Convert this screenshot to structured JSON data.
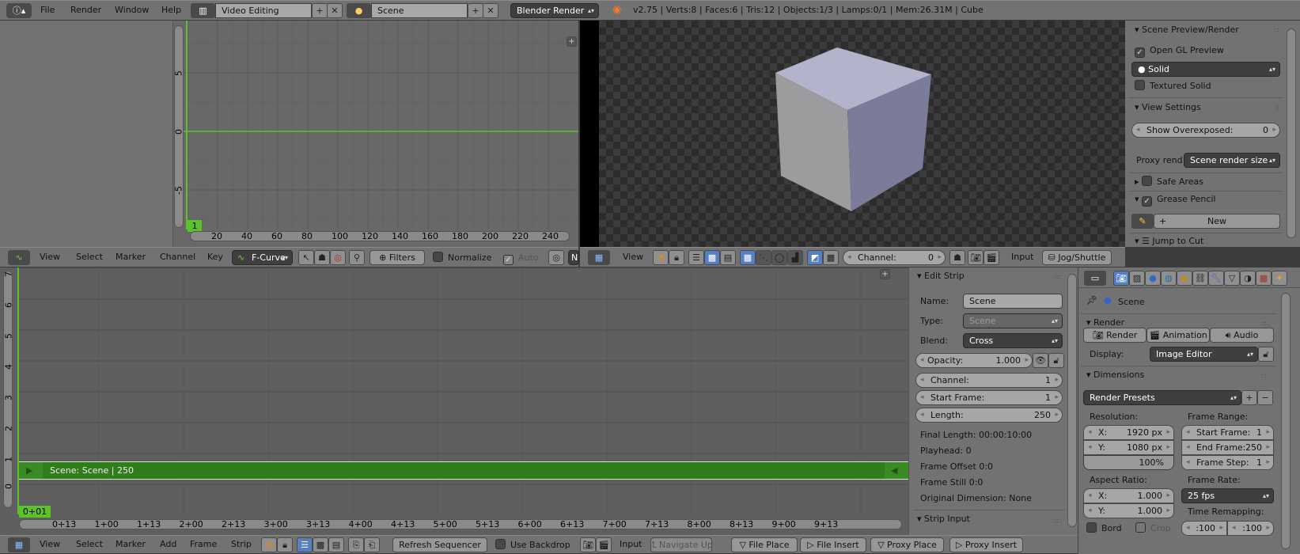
{
  "colors": {
    "accent_green": "#5bc22a",
    "strip_green": "#2f7d1b",
    "selection_blue": "#5680c2",
    "header": "#727272"
  },
  "topbar": {
    "info_icon": "info-icon",
    "menus": [
      "File",
      "Render",
      "Window",
      "Help"
    ],
    "screen_layout": "Video Editing",
    "scene": "Scene",
    "render_engine": "Blender Render",
    "stats": "v2.75 | Verts:8 | Faces:6 | Tris:12 | Objects:1/3 | Lamps:0/1 | Mem:26.31M | Cube"
  },
  "graph_editor": {
    "x_ticks": [
      "20",
      "40",
      "60",
      "80",
      "100",
      "120",
      "140",
      "160",
      "180",
      "200",
      "220",
      "240"
    ],
    "y_ticks": [
      "5",
      "0",
      "-5"
    ],
    "current_frame": "1",
    "header": {
      "menus": [
        "View",
        "Select",
        "Marker",
        "Channel",
        "Key"
      ],
      "mode": "F-Curve",
      "filters": "Filters",
      "normalize": "Normalize",
      "auto": "Auto",
      "truncated": "N"
    }
  },
  "preview": {
    "header": {
      "view": "View",
      "channel_label": "Channel:",
      "channel_value": "0",
      "input": "Input",
      "jog_shuttle": "Jog/Shuttle"
    },
    "sidebar": {
      "scene_preview_title": "Scene Preview/Render",
      "open_gl_preview": "Open GL Preview",
      "open_gl_checked": true,
      "shading": "Solid",
      "textured_solid": "Textured Solid",
      "textured_solid_checked": false,
      "view_settings_title": "View Settings",
      "show_overexposed_label": "Show Overexposed:",
      "show_overexposed_value": "0",
      "proxy_label": "Proxy rend",
      "proxy_value": "Scene render size",
      "safe_areas": "Safe Areas",
      "grease_pencil": "Grease Pencil",
      "new_button": "New",
      "jump_to_cut": "Jump to Cut"
    }
  },
  "sequencer": {
    "channels": [
      "7",
      "6",
      "5",
      "4",
      "3",
      "2",
      "1",
      "0"
    ],
    "strip_label": "Scene: Scene | 250",
    "current_frame": "0+01",
    "time_ticks": [
      "0+13",
      "1+00",
      "1+13",
      "2+00",
      "2+13",
      "3+00",
      "3+13",
      "4+00",
      "4+13",
      "5+00",
      "5+13",
      "6+00",
      "6+13",
      "7+00",
      "7+13",
      "8+00",
      "8+13",
      "9+00",
      "9+13"
    ],
    "header": {
      "menus": [
        "View",
        "Select",
        "Marker",
        "Add",
        "Frame",
        "Strip"
      ],
      "refresh": "Refresh Sequencer",
      "use_backdrop": "Use Backdrop",
      "input": "Input",
      "navigate_up": "Navigate Up",
      "file_place": "File Place",
      "file_insert": "File Insert",
      "proxy_place": "Proxy Place",
      "proxy_insert": "Proxy Insert"
    }
  },
  "edit_strip": {
    "title": "Edit Strip",
    "name_label": "Name:",
    "name_value": "Scene",
    "type_label": "Type:",
    "type_value": "Scene",
    "blend_label": "Blend:",
    "blend_value": "Cross",
    "opacity_label": "Opacity:",
    "opacity_value": "1.000",
    "channel_label": "Channel:",
    "channel_value": "1",
    "start_label": "Start Frame:",
    "start_value": "1",
    "length_label": "Length:",
    "length_value": "250",
    "final_length": "Final Length: 00:00:10:00",
    "playhead": "Playhead: 0",
    "frame_offset": "Frame Offset 0:0",
    "frame_still": "Frame Still 0:0",
    "original_dimension": "Original Dimension: None",
    "strip_input": "Strip Input"
  },
  "properties": {
    "context": "Scene",
    "render_title": "Render",
    "render_btn": "Render",
    "animation_btn": "Animation",
    "audio_btn": "Audio",
    "display_label": "Display:",
    "display_value": "Image Editor",
    "dimensions_title": "Dimensions",
    "presets": "Render Presets",
    "resolution_label": "Resolution:",
    "res_x_label": "X:",
    "res_x": "1920 px",
    "res_y_label": "Y:",
    "res_y": "1080 px",
    "res_pct": "100%",
    "frame_range_label": "Frame Range:",
    "start_label": "Start Frame:",
    "start": "1",
    "end_label": "End Frame:",
    "end": "250",
    "step_label": "Frame Step:",
    "step": "1",
    "aspect_label": "Aspect Ratio:",
    "asp_x_label": "X:",
    "asp_x": "1.000",
    "asp_y_label": "Y:",
    "asp_y": "1.000",
    "frame_rate_label": "Frame Rate:",
    "frame_rate": "25 fps",
    "time_remap_label": "Time Remapping:",
    "remap_old": ":100",
    "remap_new": ":100",
    "border": "Bord",
    "crop": "Crop"
  }
}
